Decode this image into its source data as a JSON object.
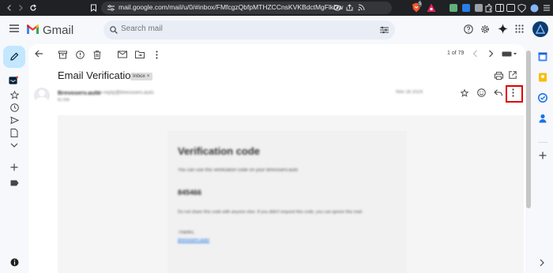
{
  "browser": {
    "url": "mail.google.com/mail/u/0/#inbox/FMfcgzQbfpMTHZCCnsKVKBdctMgFlkDw",
    "brave_badge": "5",
    "icons": [
      "back-icon",
      "forward-icon",
      "reload-icon",
      "bookmark-icon",
      "site-settings-icon",
      "eye-icon",
      "share-icon",
      "rss-icon",
      "brave-shield-icon",
      "rewards-icon",
      "extensions-icon",
      "sidebar-icon",
      "wallet-icon",
      "profile-icon",
      "menu-icon"
    ]
  },
  "header": {
    "app_name": "Gmail",
    "search_placeholder": "Search mail"
  },
  "toolbar": {
    "pagination": "1 of 79"
  },
  "message": {
    "subject": "Email Verification",
    "label": "Inbox",
    "sender": "Brevoserv.auto",
    "sender_email": "no-reply@brevoserv.auto",
    "date": "Nov 28 2024",
    "card_title": "Verification code",
    "card_intro": "You can use this verification code on your Brevoserv.auto",
    "code": "845466",
    "card_note": "Do not share this code with anyone else. If you didn't request this code, you can ignore this mail.",
    "signoff": "Thanks,",
    "link": "Brevoserv.auto"
  },
  "colors": {
    "highlight": "#e00000",
    "compose": "#c2e7ff",
    "accent_blue": "#0b57d0"
  }
}
